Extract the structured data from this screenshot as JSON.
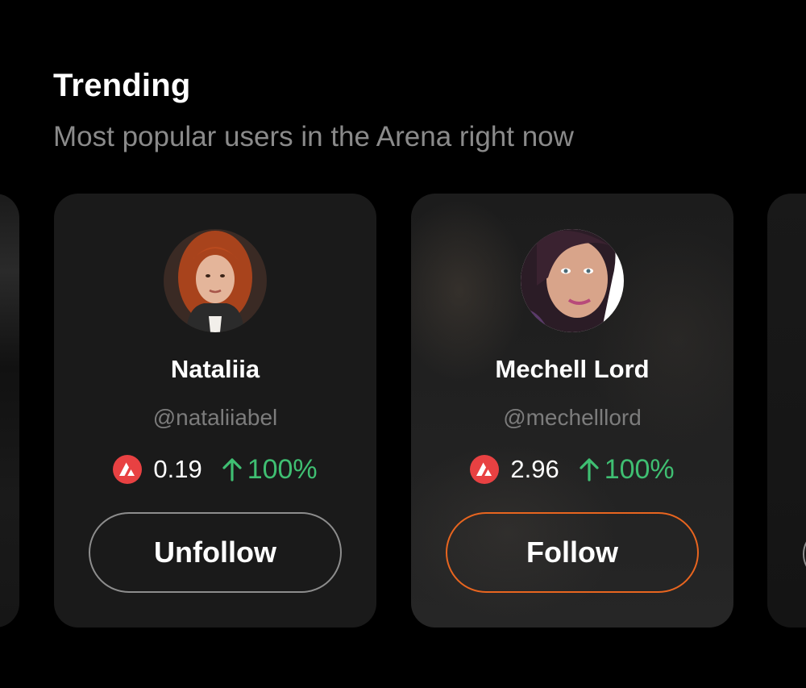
{
  "header": {
    "title": "Trending",
    "subtitle": "Most popular users in the Arena right now"
  },
  "cards": [
    {
      "name": "Nataliia",
      "handle": "@nataliiabel",
      "price": "0.19",
      "change": "100%",
      "button_label": "Unfollow",
      "following": true
    },
    {
      "name": "Mechell Lord",
      "handle": "@mechelllord",
      "price": "2.96",
      "change": "100%",
      "button_label": "Follow",
      "following": false
    }
  ],
  "colors": {
    "background": "#000000",
    "card": "#1a1a1a",
    "token_red": "#e84142",
    "positive_green": "#3fbf72",
    "follow_accent": "#e8651f",
    "muted_text": "#8a8a8a"
  },
  "icons": {
    "token": "avalanche-icon",
    "trend": "arrow-up-icon"
  }
}
